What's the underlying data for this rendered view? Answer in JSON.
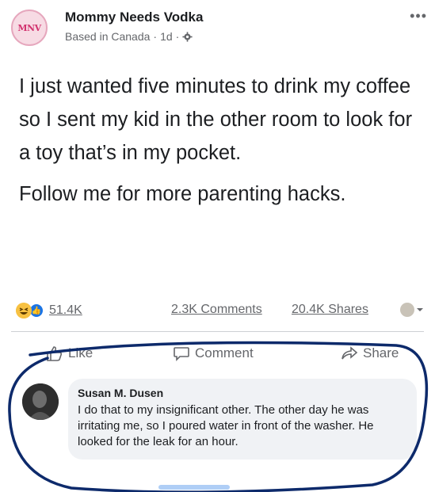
{
  "post": {
    "page_name": "Mommy Needs Vodka",
    "avatar_text": "MNV",
    "location": "Based in Canada",
    "sep1": "·",
    "time": "1d",
    "sep2": "·",
    "more_icon": "•••",
    "paragraphs": [
      "I just wanted five minutes to drink my coffee so I sent my kid in the other room to look for a toy that’s in my pocket.",
      "Follow me for more parenting hacks."
    ]
  },
  "stats": {
    "reactions_count": "51.4K",
    "comments_count": "2.3K Comments",
    "shares_count": "20.4K Shares"
  },
  "actions": {
    "like": "Like",
    "comment": "Comment",
    "share": "Share"
  },
  "comment": {
    "author": "Susan M. Dusen",
    "text": "I do that to my insignificant other.  The other day he was irritating me, so I poured water in front of the washer.  He looked for the leak for an hour."
  },
  "colors": {
    "accent": "#1b74e4",
    "annotation_ink": "#0d2a6b"
  },
  "icons": [
    "gear-icon",
    "more-icon",
    "haha-reaction-icon",
    "like-reaction-icon",
    "like-icon",
    "comment-icon",
    "share-icon",
    "chevron-down-icon"
  ]
}
